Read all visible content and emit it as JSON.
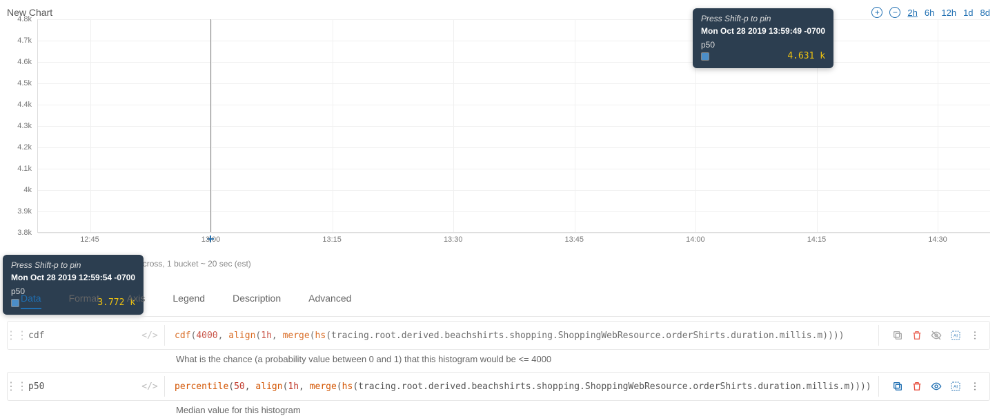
{
  "header": {
    "title": "New Chart",
    "zoom_in_title": "Zoom in",
    "zoom_out_title": "Zoom out",
    "time_options": [
      "2h",
      "6h",
      "12h",
      "1d",
      "8d"
    ],
    "time_active": "2h"
  },
  "chart_data": {
    "type": "line",
    "title": "",
    "xlabel": "",
    "ylabel": "",
    "ylim": [
      3.8,
      4.8
    ],
    "y_ticks": [
      "4.8k",
      "4.7k",
      "4.6k",
      "4.5k",
      "4.4k",
      "4.3k",
      "4.2k",
      "4.1k",
      "4k",
      "3.9k",
      "3.8k"
    ],
    "x_ticks": [
      "12:45",
      "13:00",
      "13:15",
      "13:30",
      "13:45",
      "14:00",
      "14:15",
      "14:30"
    ],
    "series": [
      {
        "name": "p50",
        "color": "#4b8ec9",
        "points": [
          {
            "x_label": "12:59:54",
            "x_frac": 0.181,
            "value": 3772,
            "display": "3.772 k"
          },
          {
            "x_label": "13:59:49",
            "x_frac": 0.693,
            "value": 4631,
            "display": "4.631 k"
          }
        ]
      }
    ],
    "cursor_x_frac": 0.181
  },
  "bucket_note": "point buckets across, 1 bucket ~ 20 sec (est)",
  "tooltips": {
    "pin_hint": "Press Shift-p to pin",
    "t1": {
      "timestamp": "Mon Oct 28 2019 12:59:54 -0700",
      "series_label": "p50",
      "value": "3.772 k"
    },
    "t2": {
      "timestamp": "Mon Oct 28 2019 13:59:49 -0700",
      "series_label": "p50",
      "value": "4.631 k"
    }
  },
  "tabs": {
    "items": [
      "Data",
      "Format",
      "Axis",
      "Legend",
      "Description",
      "Advanced"
    ],
    "active": "Data"
  },
  "queries": [
    {
      "id": "cdf",
      "name": "cdf",
      "disabled": true,
      "expr_tokens": [
        {
          "t": "fn",
          "v": "cdf"
        },
        {
          "t": "norm",
          "v": "("
        },
        {
          "t": "num",
          "v": "4000"
        },
        {
          "t": "norm",
          "v": ", "
        },
        {
          "t": "kw",
          "v": "align"
        },
        {
          "t": "norm",
          "v": "("
        },
        {
          "t": "num",
          "v": "1h"
        },
        {
          "t": "norm",
          "v": ", "
        },
        {
          "t": "kw",
          "v": "merge"
        },
        {
          "t": "norm",
          "v": "("
        },
        {
          "t": "kw",
          "v": "hs"
        },
        {
          "t": "norm",
          "v": "(tracing.root.derived.beachshirts.shopping.ShoppingWebResource.orderShirts.duration.millis.m))))"
        }
      ],
      "description": "What is the chance (a probability value between 0 and 1) that this histogram would be <= 4000"
    },
    {
      "id": "p50",
      "name": "p50",
      "disabled": false,
      "expr_tokens": [
        {
          "t": "fn",
          "v": "percentile"
        },
        {
          "t": "norm",
          "v": "("
        },
        {
          "t": "num",
          "v": "50"
        },
        {
          "t": "norm",
          "v": ", "
        },
        {
          "t": "kw",
          "v": "align"
        },
        {
          "t": "norm",
          "v": "("
        },
        {
          "t": "num",
          "v": "1h"
        },
        {
          "t": "norm",
          "v": ", "
        },
        {
          "t": "kw",
          "v": "merge"
        },
        {
          "t": "norm",
          "v": "("
        },
        {
          "t": "kw",
          "v": "hs"
        },
        {
          "t": "norm",
          "v": "(tracing.root.derived.beachshirts.shopping.ShoppingWebResource.orderShirts.duration.millis.m))))"
        }
      ],
      "description": "Median value for this histogram"
    }
  ],
  "icons": {
    "drag": "⋮⋮",
    "code": "</>"
  }
}
